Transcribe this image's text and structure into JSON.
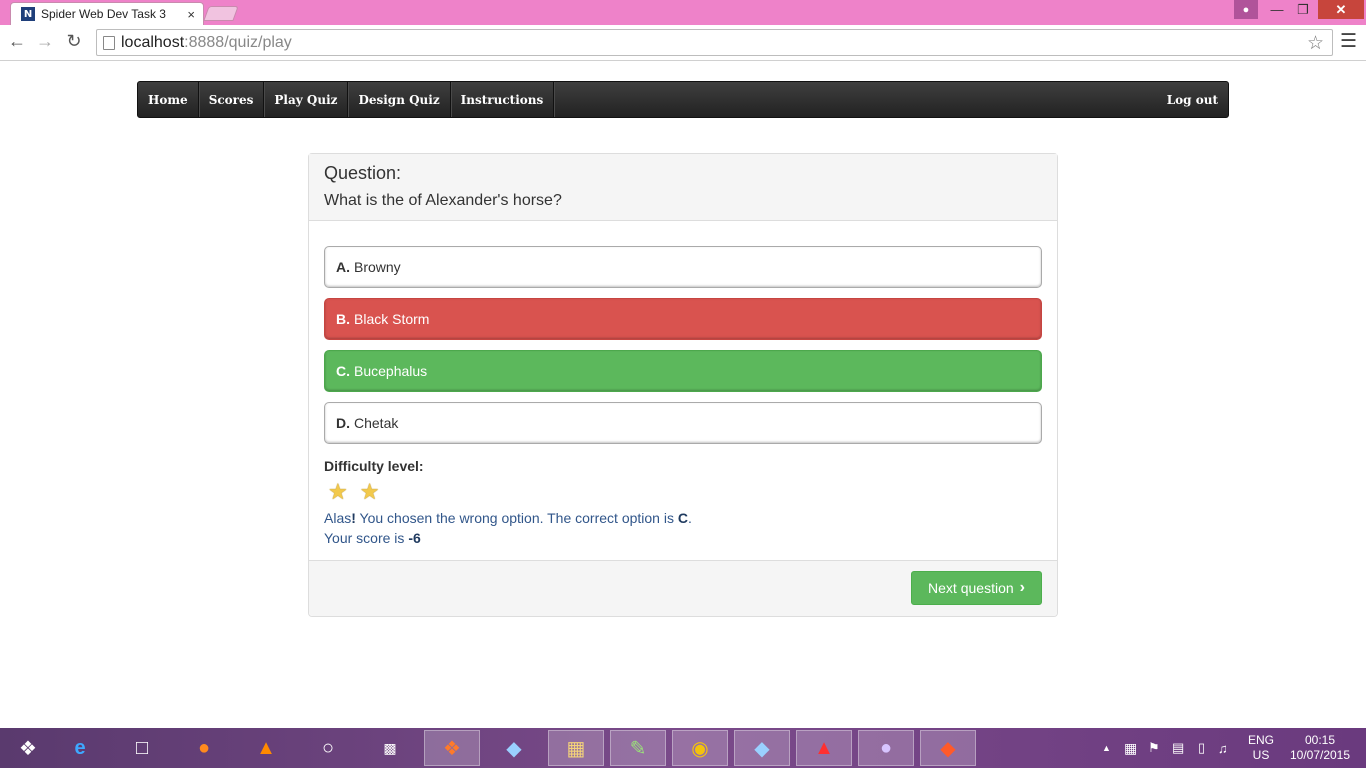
{
  "browser": {
    "tab_title": "Spider Web Dev Task 3",
    "tab_favicon": "N",
    "tab_close": "×",
    "url_host": "localhost",
    "url_path": ":8888/quiz/play",
    "icons": [
      "back-icon",
      "forward-icon",
      "reload-icon",
      "bookmark-star-icon",
      "menu-icon"
    ]
  },
  "navbar": {
    "items": [
      {
        "label": "Home"
      },
      {
        "label": "Scores"
      },
      {
        "label": "Play Quiz"
      },
      {
        "label": "Design Quiz"
      },
      {
        "label": "Instructions"
      }
    ],
    "logout_label": "Log out"
  },
  "question": {
    "label": "Question:",
    "text": "What is the of Alexander's horse?"
  },
  "options": [
    {
      "letter": "A.",
      "text": "Browny",
      "state": "neutral"
    },
    {
      "letter": "B.",
      "text": "Black Storm",
      "state": "wrong"
    },
    {
      "letter": "C.",
      "text": "Bucephalus",
      "state": "correct"
    },
    {
      "letter": "D.",
      "text": "Chetak",
      "state": "neutral"
    }
  ],
  "difficulty": {
    "label": "Difficulty level:",
    "stars": 2
  },
  "feedback": {
    "alas": "Alas",
    "exclaim": "!",
    "message": " You chosen the wrong option. The correct option is ",
    "correct_option": "C",
    "period": ".",
    "score_prefix": "Your score is ",
    "score": "-6"
  },
  "footer": {
    "next_label": "Next question"
  },
  "colors": {
    "wrong": "#d9534f",
    "correct": "#5cb85c",
    "navbar": "#2b2b2b",
    "titlebar": "#ee82c9"
  },
  "taskbar": {
    "apps": [
      "windows-start-icon",
      "internet-explorer-icon",
      "file-icon",
      "firefox-icon",
      "vlc-icon",
      "hp-icon",
      "cmd-icon",
      "xampp-icon",
      "phpstorm-icon",
      "file-explorer-icon",
      "notepad-plus-icon",
      "chrome-icon",
      "phpstorm-icon",
      "acrobat-icon",
      "github-icon",
      "git-icon"
    ],
    "lang_top": "ENG",
    "lang_bottom": "US",
    "time": "00:15",
    "date": "10/07/2015"
  }
}
